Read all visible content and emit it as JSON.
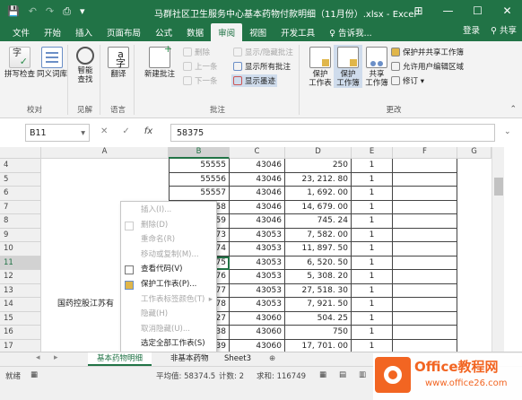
{
  "window": {
    "title": "马群社区卫生服务中心基本药物付款明细（11月份）.xlsx - Excel",
    "controls": [
      "⊞",
      "—",
      "☐",
      "✕"
    ]
  },
  "qat": [
    "💾",
    "↶",
    "↷",
    "⎙",
    "▾"
  ],
  "tabs": [
    "文件",
    "开始",
    "插入",
    "页面布局",
    "公式",
    "数据",
    "审阅",
    "视图",
    "开发工具",
    "♀ 告诉我..."
  ],
  "active_tab": "审阅",
  "account": {
    "login": "登录",
    "share": "共享"
  },
  "ribbon": {
    "proofing": {
      "label": "校对",
      "spell": "拼写检查",
      "thesaurus": "同义词库"
    },
    "insights": {
      "label": "见解",
      "smart": "智能\n查找"
    },
    "language": {
      "label": "语言",
      "translate": "翻译"
    },
    "comments": {
      "label": "批注",
      "new": "新建批注",
      "delete": "删除",
      "prev": "上一条",
      "next": "下一条",
      "showhide": "显示/隐藏批注",
      "showall": "显示所有批注",
      "ink": "显示墨迹"
    },
    "changes": {
      "label": "更改",
      "protect_sheet": "保护\n工作表",
      "protect_book": "保护\n工作簿",
      "share_book": "共享\n工作簿",
      "protect_share": "保护并共享工作簿",
      "allow_edit": "允许用户编辑区域",
      "track": "修订 ▾"
    }
  },
  "formula_bar": {
    "name_box": "B11",
    "value": "58375",
    "fx": "fx",
    "cancel": "✕",
    "enter": "✓"
  },
  "columns": [
    "A",
    "B",
    "C",
    "D",
    "E",
    "F",
    "G"
  ],
  "rows": [
    {
      "n": "4",
      "a": "",
      "b": "55555",
      "c": "43046",
      "d": "250",
      "e": "1"
    },
    {
      "n": "5",
      "a": "",
      "b": "55556",
      "c": "43046",
      "d": "23, 212. 80",
      "e": "1"
    },
    {
      "n": "6",
      "a": "",
      "b": "55557",
      "c": "43046",
      "d": "1, 692. 00",
      "e": "1"
    },
    {
      "n": "7",
      "a": "",
      "b": "58",
      "c": "43046",
      "d": "14, 679. 00",
      "e": "1"
    },
    {
      "n": "8",
      "a": "",
      "b": "59",
      "c": "43046",
      "d": "745. 24",
      "e": "1"
    },
    {
      "n": "9",
      "a": "",
      "b": "73",
      "c": "43053",
      "d": "7, 582. 00",
      "e": "1"
    },
    {
      "n": "10",
      "a": "",
      "b": "74",
      "c": "43053",
      "d": "11, 897. 50",
      "e": "1"
    },
    {
      "n": "11",
      "a": "",
      "b": "75",
      "c": "43053",
      "d": "6, 520. 50",
      "e": "1"
    },
    {
      "n": "12",
      "a": "",
      "b": "76",
      "c": "43053",
      "d": "5, 308. 20",
      "e": "1"
    },
    {
      "n": "13",
      "a": "",
      "b": "77",
      "c": "43053",
      "d": "27, 518. 30",
      "e": "1"
    },
    {
      "n": "14",
      "a": "国药控股江苏有",
      "b": "78",
      "c": "43053",
      "d": "7, 921. 50",
      "e": "1"
    },
    {
      "n": "15",
      "a": "",
      "b": "27",
      "c": "43060",
      "d": "504. 25",
      "e": "1"
    },
    {
      "n": "16",
      "a": "",
      "b": "38",
      "c": "43060",
      "d": "750",
      "e": "1"
    },
    {
      "n": "17",
      "a": "",
      "b": "39",
      "c": "43060",
      "d": "17, 701. 00",
      "e": "1"
    }
  ],
  "context_menu": [
    {
      "label": "插入(I)...",
      "enabled": false
    },
    {
      "label": "删除(D)",
      "enabled": false
    },
    {
      "label": "重命名(R)",
      "enabled": false
    },
    {
      "label": "移动或复制(M)...",
      "enabled": false
    },
    {
      "label": "查看代码(V)",
      "enabled": true
    },
    {
      "label": "保护工作表(P)...",
      "enabled": true
    },
    {
      "label": "工作表标签颜色(T)",
      "enabled": false,
      "submenu": "▸"
    },
    {
      "label": "隐藏(H)",
      "enabled": false
    },
    {
      "label": "取消隐藏(U)...",
      "enabled": false
    },
    {
      "label": "选定全部工作表(S)",
      "enabled": true
    }
  ],
  "sheet_tabs": [
    "基本药物明细",
    "非基本药物",
    "Sheet3"
  ],
  "sheet_add": "⊕",
  "status": {
    "ready": "就绪",
    "avg": "平均值: 58374.5",
    "count": "计数: 2",
    "sum": "求和: 116749"
  },
  "watermark": {
    "brand": "Office教程网",
    "url": "www.office26.com"
  }
}
